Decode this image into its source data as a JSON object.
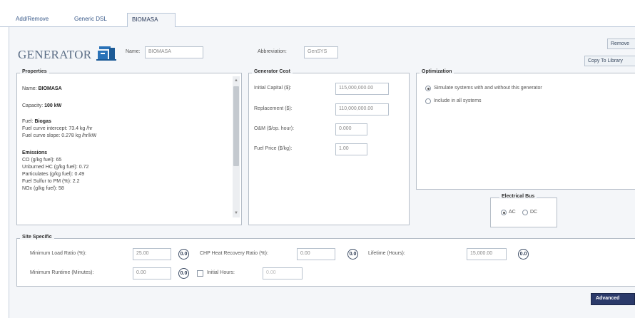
{
  "tabs": [
    {
      "label": "Add/Remove"
    },
    {
      "label": "Generic DSL"
    },
    {
      "label": "BIOMASA"
    }
  ],
  "header": {
    "title": "GENERATOR",
    "name_label": "Name:",
    "name_value": "BIOMASA",
    "abbreviation_label": "Abbreviation:",
    "abbreviation_value": "GenSYS",
    "remove_button": "Remove",
    "copy_button": "Copy To Library"
  },
  "properties": {
    "legend": "Properties",
    "name_label": "Name:",
    "name_value": "BIOMASA",
    "capacity_label": "Capacity:",
    "capacity_value": "100 kW",
    "fuel_label": "Fuel:",
    "fuel_value": "Biogas",
    "fuel_curve_intercept": "Fuel curve intercept: 73.4 kg /hr",
    "fuel_curve_slope": "Fuel curve slope: 0.278 kg /hr/kW",
    "emissions_label": "Emissions",
    "emissions": [
      "CO (g/kg fuel): 65",
      "Unburned HC (g/kg fuel): 0.72",
      "Particulates (g/kg fuel): 0.49",
      "Fuel Sulfur to PM (%): 2.2",
      "NOx (g/kg fuel): 58"
    ]
  },
  "generator_cost": {
    "legend": "Generator Cost",
    "fields": [
      {
        "label": "Initial Capital ($):",
        "value": "115,000,000.00"
      },
      {
        "label": "Replacement ($):",
        "value": "110,000,000.00"
      },
      {
        "label": "O&M ($/op. hour):",
        "value": "0.000"
      },
      {
        "label": "Fuel Price ($/kg):",
        "value": "1.00"
      }
    ]
  },
  "optimization": {
    "legend": "Optimization",
    "options": [
      {
        "label": "Simulate systems with and without this generator",
        "selected": true
      },
      {
        "label": "Include in all systems",
        "selected": false
      }
    ]
  },
  "electrical_bus": {
    "legend": "Electrical Bus",
    "options": [
      {
        "label": "AC",
        "selected": true
      },
      {
        "label": "DC",
        "selected": false
      }
    ]
  },
  "site_specific": {
    "legend": "Site Specific",
    "min_load_ratio_label": "Minimum Load Ratio (%):",
    "min_load_ratio_value": "25.00",
    "chp_label": "CHP Heat Recovery Ratio (%):",
    "chp_value": "0.00",
    "lifetime_label": "Lifetime (Hours):",
    "lifetime_value": "15,000.00",
    "min_runtime_label": "Minimum Runtime (Minutes):",
    "min_runtime_value": "0.00",
    "initial_hours_label": "Initial Hours:",
    "initial_hours_value": "0.00",
    "unit_icon_text": "0.0"
  },
  "footer": {
    "advanced_button": "Advanced"
  },
  "colors": {
    "panel_bg": "#f4f6f9",
    "title": "#5c6e86",
    "accent_button": "#2b3a6a",
    "icon_blue": "#2a72b8"
  },
  "icons": [
    "generator-icon",
    "unit-icon"
  ]
}
